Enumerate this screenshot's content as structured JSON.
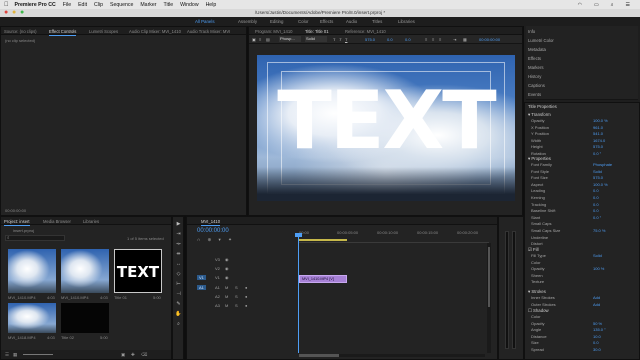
{
  "mac_menu": {
    "app": "Premiere Pro CC",
    "items": [
      "File",
      "Edit",
      "Clip",
      "Sequence",
      "Marker",
      "Title",
      "Window",
      "Help"
    ]
  },
  "title_path": "/Users/Justin/Documents/Adobe/Premiere Pro/8.0/insert.prproj *",
  "workspaces": {
    "items": [
      "All Panels",
      "Assembly",
      "Editing",
      "Color",
      "Effects",
      "Audio",
      "Titles",
      "Libraries"
    ],
    "active": "All Panels"
  },
  "source_panel": {
    "tabs": [
      "Source: (no clips)",
      "Effect Controls",
      "Lumetri Scopes",
      "Audio Clip Mixer: MVI_1410",
      "Audio Track Mixer: MVI"
    ],
    "message": "(no clip selected)",
    "timecode": "00:00:00:00"
  },
  "title_panel": {
    "tabs": [
      "Program: MVI_1410",
      "Title: Title 01",
      "Reference: MVI_1410"
    ],
    "toolbar": {
      "font": "Phosp...",
      "style": "Solid",
      "size": "575.0",
      "kerning": "0.0",
      "leading": "0.0",
      "timecode": "00:00:00:00"
    },
    "text": "TEXT"
  },
  "right_panels": {
    "items": [
      "Info",
      "Lumetri Color",
      "Metadata",
      "Effects",
      "Markers",
      "History",
      "Captions",
      "Events"
    ]
  },
  "title_properties": {
    "header": "Title Properties",
    "transform_label": "Transform",
    "transform": [
      {
        "k": "Opacity",
        "v": "100.0 %"
      },
      {
        "k": "X Position",
        "v": "961.0"
      },
      {
        "k": "Y Position",
        "v": "541.0"
      },
      {
        "k": "Width",
        "v": "1674.0"
      },
      {
        "k": "Height",
        "v": "575.0"
      },
      {
        "k": "Rotation",
        "v": "0.0 °"
      }
    ],
    "properties_label": "Properties",
    "properties": [
      {
        "k": "Font Family",
        "v": "Phosphate"
      },
      {
        "k": "Font Style",
        "v": "Solid"
      },
      {
        "k": "Font Size",
        "v": "575.0"
      },
      {
        "k": "Aspect",
        "v": "100.0 %"
      },
      {
        "k": "Leading",
        "v": "0.0"
      },
      {
        "k": "Kerning",
        "v": "0.0"
      },
      {
        "k": "Tracking",
        "v": "0.0"
      },
      {
        "k": "Baseline Shift",
        "v": "0.0"
      },
      {
        "k": "Slant",
        "v": "0.0 °"
      },
      {
        "k": "Small Caps",
        "v": ""
      },
      {
        "k": "Small Caps Size",
        "v": "75.0 %"
      },
      {
        "k": "Underline",
        "v": ""
      },
      {
        "k": "Distort",
        "v": ""
      }
    ],
    "fill_label": "Fill",
    "fill": [
      {
        "k": "Fill Type",
        "v": "Solid"
      },
      {
        "k": "Color",
        "v": ""
      },
      {
        "k": "Opacity",
        "v": "100 %"
      },
      {
        "k": "Sheen",
        "v": ""
      },
      {
        "k": "Texture",
        "v": ""
      }
    ],
    "strokes_label": "Strokes",
    "strokes": [
      {
        "k": "Inner Strokes",
        "v": "Add"
      },
      {
        "k": "Outer Strokes",
        "v": "Add"
      }
    ],
    "shadow_label": "Shadow",
    "shadow": [
      {
        "k": "Color",
        "v": ""
      },
      {
        "k": "Opacity",
        "v": "50 %"
      },
      {
        "k": "Angle",
        "v": "135.0 °"
      },
      {
        "k": "Distance",
        "v": "10.0"
      },
      {
        "k": "Size",
        "v": "0.0"
      },
      {
        "k": "Spread",
        "v": "30.0"
      }
    ]
  },
  "project_panel": {
    "tabs": [
      "Project: insert",
      "Media Browser",
      "Libraries"
    ],
    "project_file": "insert.prproj",
    "count": "1 of 5 items selected",
    "items": [
      {
        "name": "MVI_1410.MP4",
        "dur": "4:03"
      },
      {
        "name": "MVI_1410.MP4",
        "dur": "4:03"
      },
      {
        "name": "Title 01",
        "dur": "5:00"
      },
      {
        "name": "MVI_1418.MP4",
        "dur": "4:03"
      },
      {
        "name": "Title 02",
        "dur": "5:00"
      }
    ],
    "thumb_text": "TEXT"
  },
  "timeline": {
    "tab": "MVI_1410",
    "timecode": "00:00:00:00",
    "ruler": [
      "00:00",
      "00:00:05:00",
      "00:00:10:00",
      "00:00:15:00",
      "00:00:20:00"
    ],
    "tracks": [
      "V3",
      "V2",
      "V1",
      "A1",
      "A2",
      "A3"
    ],
    "track_labels": [
      "V1",
      "A1"
    ],
    "clip_label": "MVI_1410.MP4 [V]"
  },
  "colors": {
    "accent": "#4e9ef5",
    "clip": "#a781d6",
    "panel": "#232323"
  }
}
